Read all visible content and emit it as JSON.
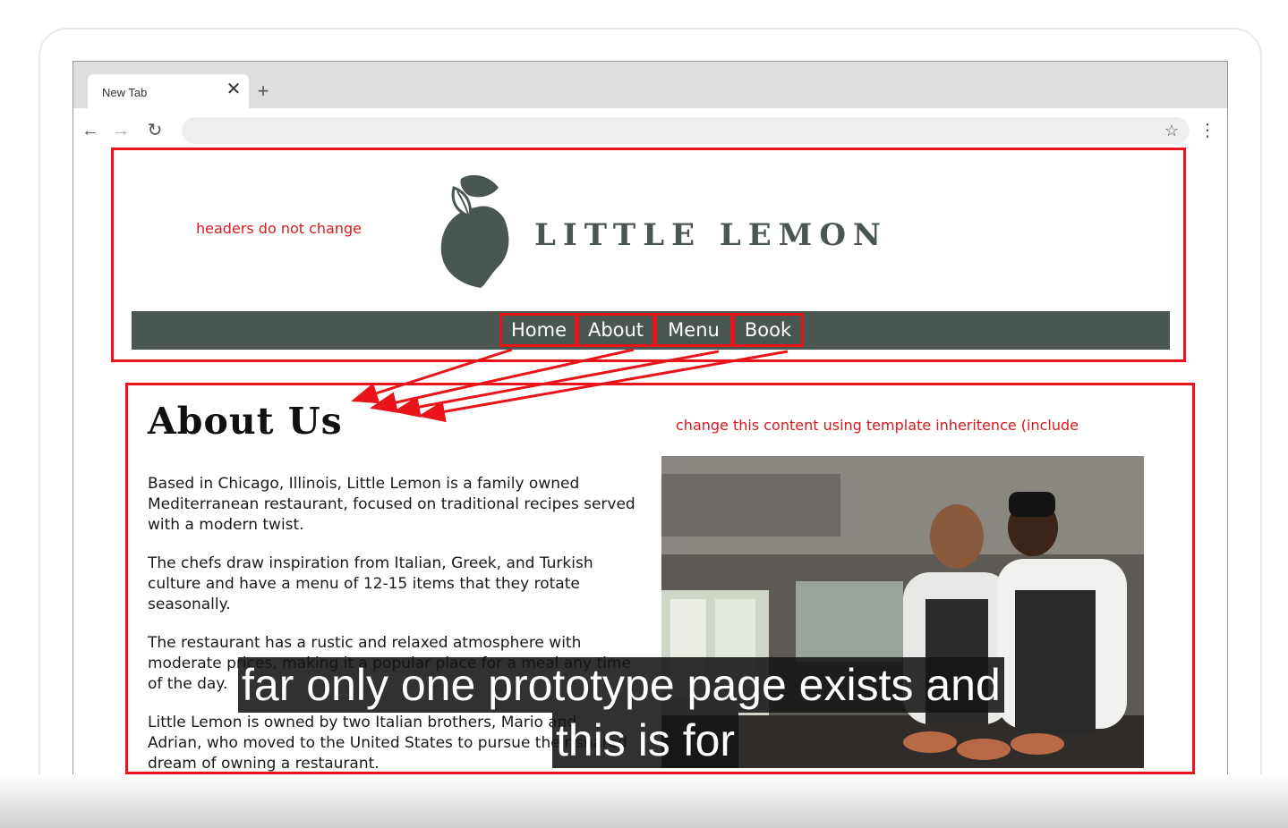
{
  "browser": {
    "tab_title": "New Tab",
    "tab_close": "✕",
    "new_tab": "+",
    "back": "←",
    "forward": "→",
    "reload": "↻",
    "url": "",
    "bookmark": "☆",
    "menu": "⋮"
  },
  "site": {
    "brand": "LITTLE LEMON",
    "brand_color": "#4a5751",
    "nav": [
      "Home",
      "About",
      "Menu",
      "Book"
    ]
  },
  "about": {
    "heading": "About Us",
    "paragraphs": [
      "Based in Chicago, Illinois, Little Lemon is a family owned Mediterranean restaurant, focused on traditional recipes served with a modern twist.",
      "The chefs draw inspiration from Italian, Greek, and Turkish culture and have a menu of 12-15 items that they rotate seasonally.",
      "The restaurant has a rustic and relaxed atmosphere with moderate prices, making it a popular place for a meal any time of the day.",
      "Little Lemon is owned by two Italian brothers, Mario and Adrian, who moved to the United States to pursue their shared dream of owning a restaurant."
    ]
  },
  "annotations": {
    "header_note": "headers do not change",
    "content_note": "change this content using template inheritence (include",
    "color": "#e8141a"
  },
  "captions": {
    "line1": "far only one prototype page exists and",
    "line2": "this is for"
  }
}
